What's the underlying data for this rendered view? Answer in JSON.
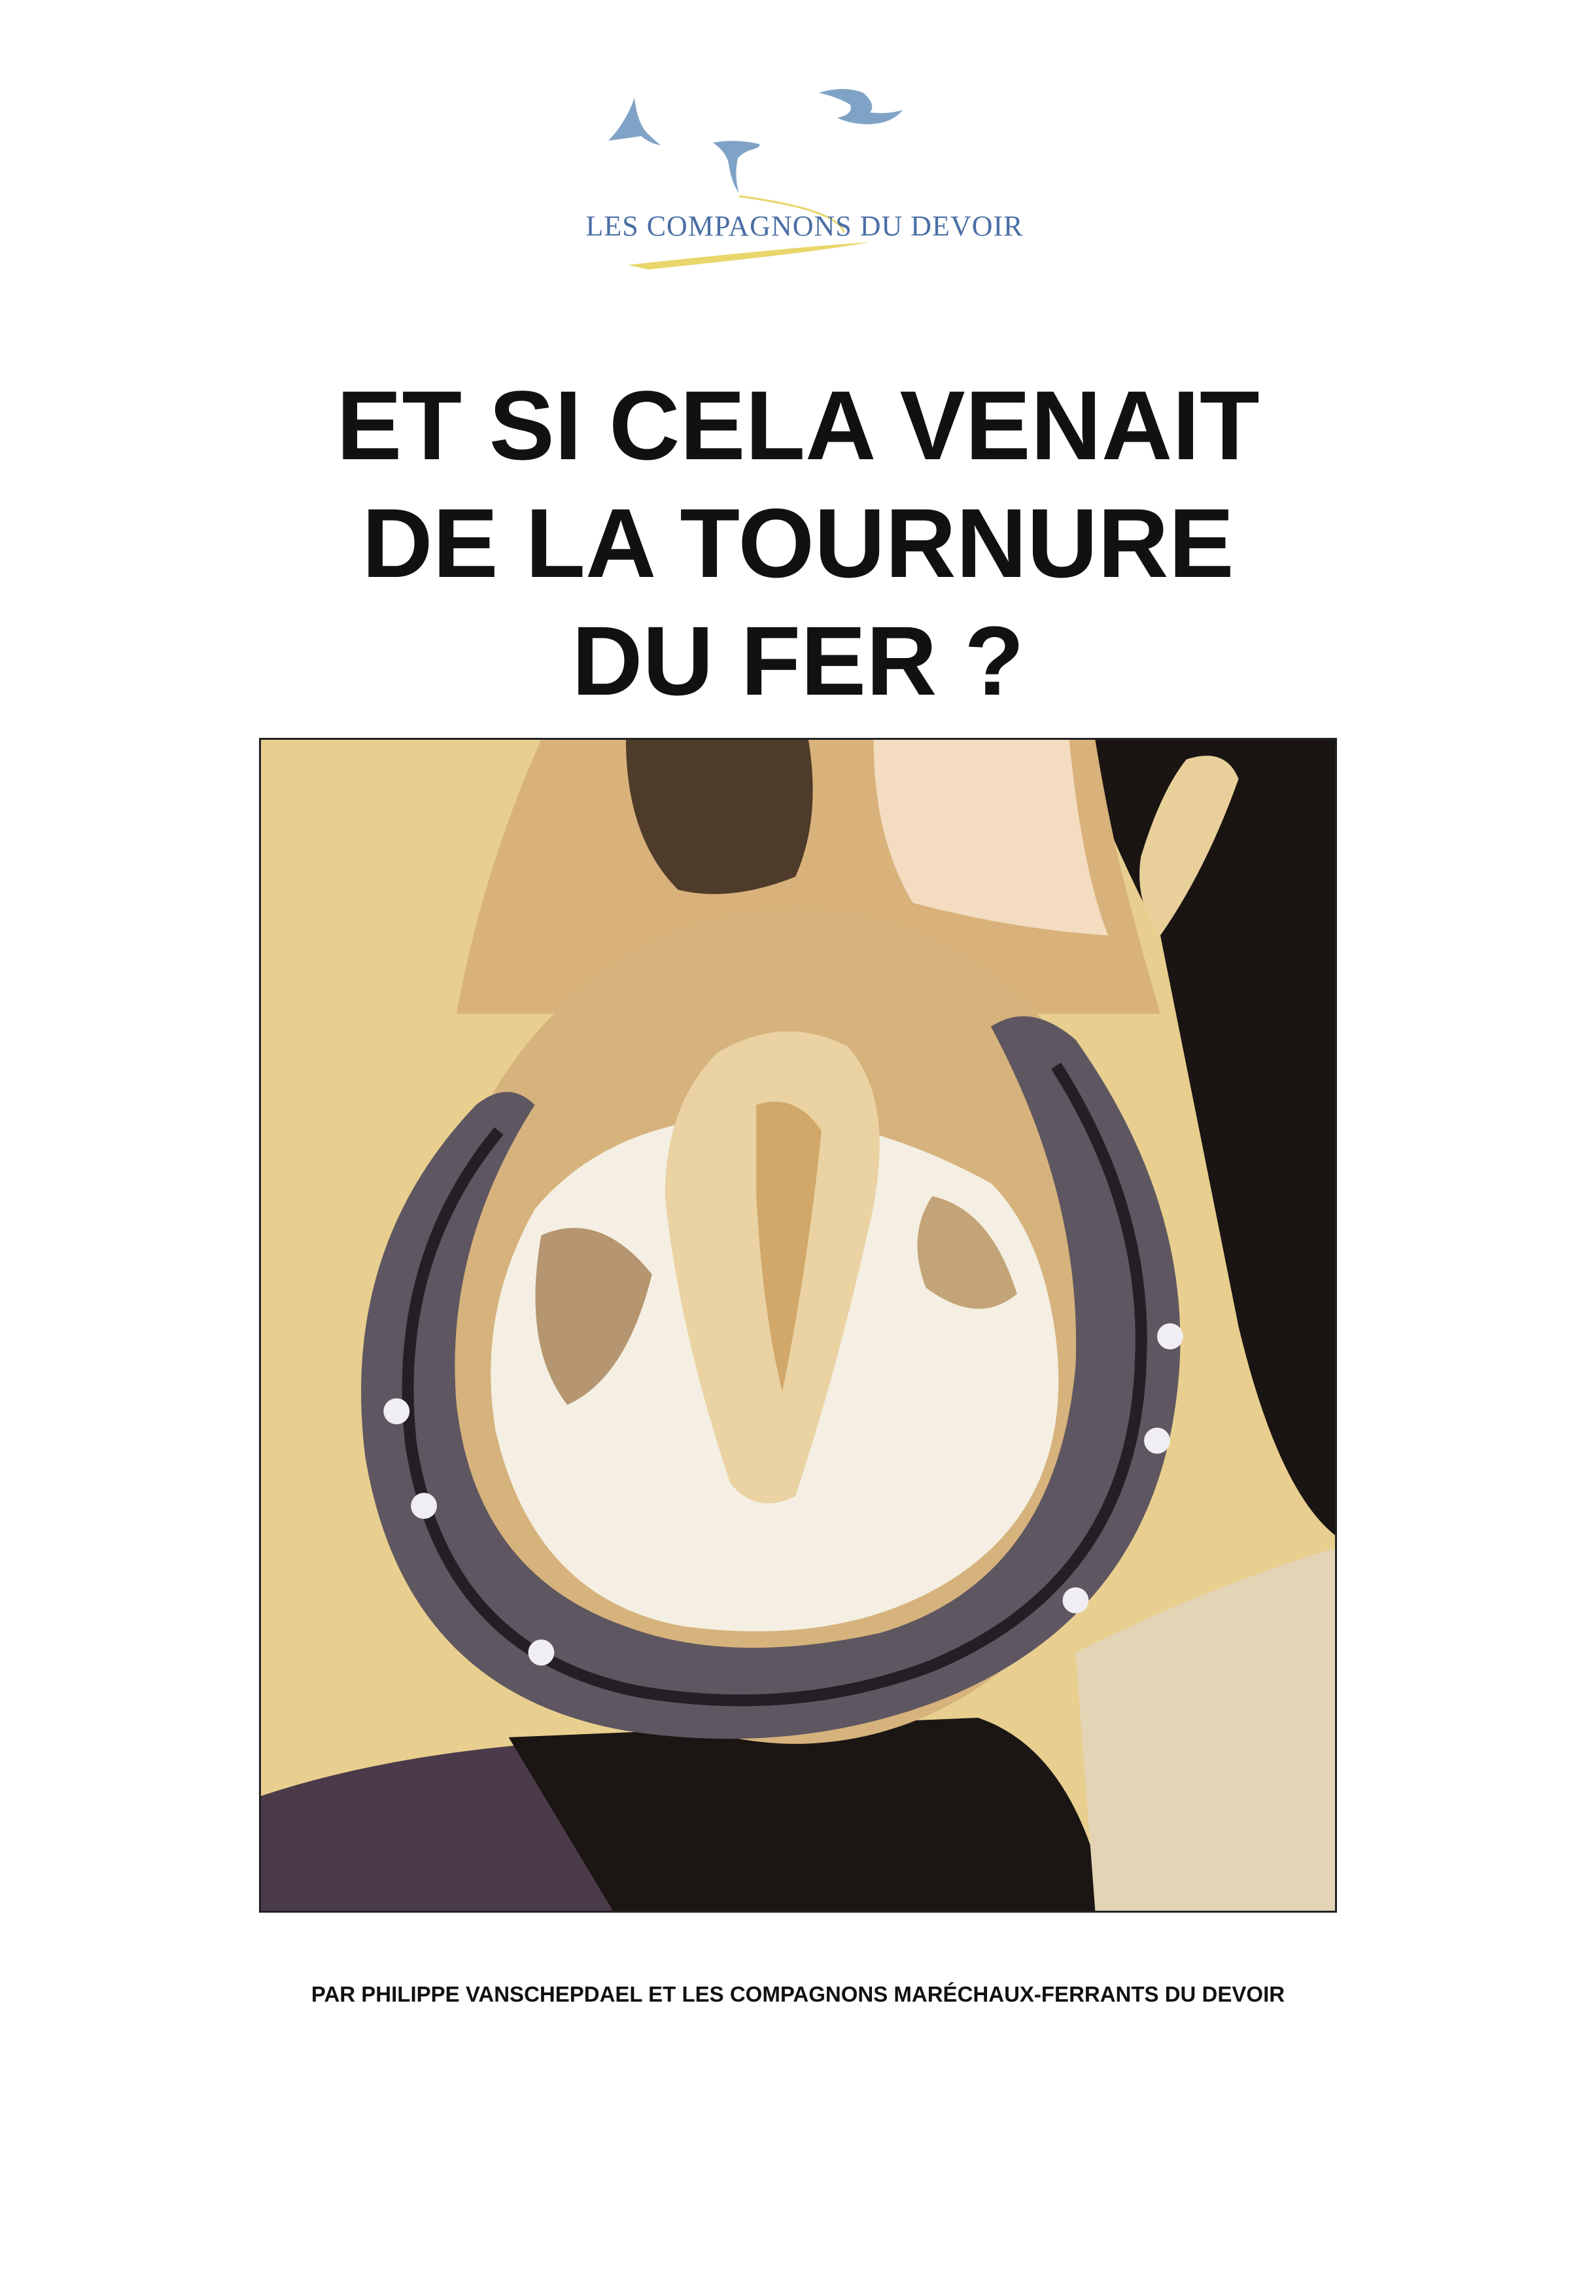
{
  "logo": {
    "text": "LES COMPAGNONS DU DEVOIR",
    "bird_color": "#7fa3c6",
    "swoosh_color": "#e8d66a"
  },
  "title": {
    "lines": [
      "ET SI CELA VENAIT",
      "DE LA TOURNURE",
      "DU FER ?"
    ]
  },
  "cover_image": {
    "icon": "horseshoe-hoof-painting"
  },
  "byline": "PAR PHILIPPE VANSCHEPDAEL ET LES COMPAGNONS MARÉCHAUX-FERRANTS DU DEVOIR"
}
